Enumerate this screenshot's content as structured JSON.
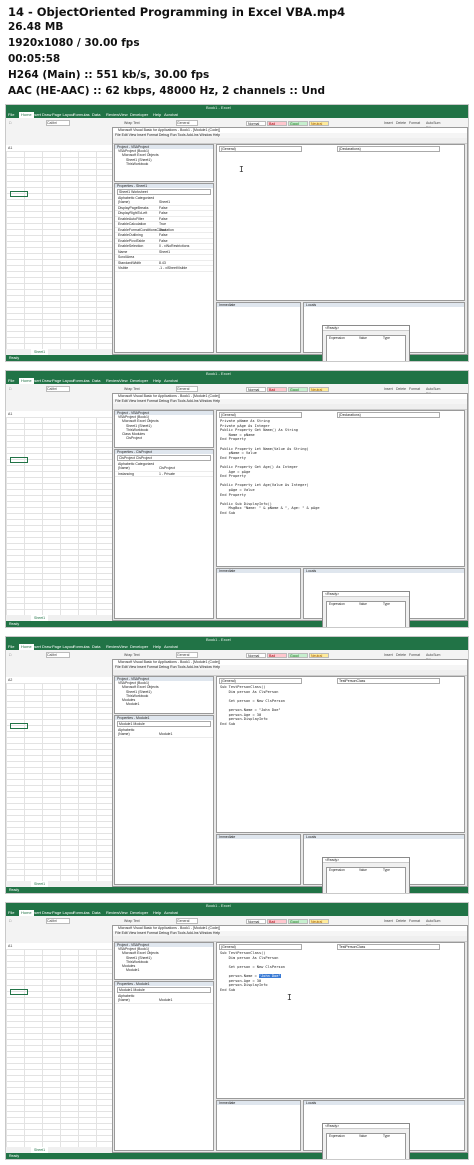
{
  "header": {
    "title": "14 - ObjectOriented Programming in Excel VBA.mp4",
    "size": "26.48 MB",
    "resolution": "1920x1080 / 30.00 fps",
    "duration": "00:05:58",
    "video": "H264 (Main) :: 551 kb/s, 30.00 fps",
    "audio": "AAC (HE-AAC) :: 62 kbps, 48000 Hz, 2 channels :: Und"
  },
  "excel": {
    "titlebar": "Book1 - Excel",
    "tabs": [
      "File",
      "Home",
      "Insert",
      "Draw",
      "Page Layout",
      "Formulas",
      "Data",
      "Review",
      "View",
      "Developer",
      "Help",
      "Acrobat"
    ],
    "ribbon": {
      "font": "Calibri",
      "wrap": "Wrap Text",
      "merge": "Merge & Center",
      "number": "General",
      "cond": "Conditional Formatting",
      "format_table": "Format as Table",
      "styles": [
        "Normal",
        "Bad",
        "Good",
        "Neutral",
        "Calculation",
        "Check Cell",
        "Explanatory",
        "Input"
      ],
      "insert": "Insert",
      "delete": "Delete",
      "format": "Format",
      "autosum": "AutoSum",
      "fill": "Fill",
      "clear": "Clear",
      "sort": "Sort & Filter",
      "find": "Find & Select"
    },
    "name_box": [
      "A1",
      "A1",
      "A2",
      "A1"
    ],
    "sheet_tab": "Sheet1",
    "status": "Ready"
  },
  "vbe": {
    "title": "Microsoft Visual Basic for Applications - Book1 - [Module1 (Code)]",
    "menu": "File  Edit  View  Insert  Format  Debug  Run  Tools  Add-Ins  Window  Help",
    "project_header": "Project - VBAProject",
    "properties_header": [
      "Properties - Sheet1",
      "Properties - ClsProject",
      "Properties - Module1",
      "Properties - Module1"
    ],
    "immediate": "Immediate",
    "locals": "Locals",
    "locals_header": [
      "<Ready>",
      "<Ready>",
      "<Ready>",
      "<Ready>"
    ],
    "locals_cols": [
      "Expression",
      "Value",
      "Type"
    ],
    "frames": [
      {
        "tree": [
          "VBAProject (Book1)",
          "Microsoft Excel Objects",
          "Sheet1 (Sheet1)",
          "ThisWorkbook"
        ],
        "prop_obj": "Sheet1 Worksheet",
        "prop_tabs": "Alphabetic  Categorized",
        "props": [
          [
            "(Name)",
            "Sheet1"
          ],
          [
            "DisplayPageBreaks",
            "False"
          ],
          [
            "DisplayRightToLeft",
            "False"
          ],
          [
            "EnableAutoFilter",
            "False"
          ],
          [
            "EnableCalculation",
            "True"
          ],
          [
            "EnableFormatConditionsCalculation",
            "True"
          ],
          [
            "EnableOutlining",
            "False"
          ],
          [
            "EnablePivotTable",
            "False"
          ],
          [
            "EnableSelection",
            "0 - xlNoRestrictions"
          ],
          [
            "Name",
            "Sheet1"
          ],
          [
            "ScrollArea",
            ""
          ],
          [
            "StandardWidth",
            "8.43"
          ],
          [
            "Visible",
            "-1 - xlSheetVisible"
          ]
        ],
        "combo_left": "(General)",
        "combo_right": "(Declarations)",
        "code": ""
      },
      {
        "tree": [
          "VBAProject (Book1)",
          "Microsoft Excel Objects",
          "Sheet1 (Sheet1)",
          "ThisWorkbook",
          "Class Modules",
          "ClsProject"
        ],
        "prop_obj": "ClsProject ClsProject",
        "prop_tabs": "Alphabetic  Categorized",
        "props": [
          [
            "(Name)",
            "ClsProject"
          ],
          [
            "Instancing",
            "1 - Private"
          ]
        ],
        "combo_left": "(General)",
        "combo_right": "(Declarations)",
        "code": "Private pName As String\nPrivate pAge As Integer\nPublic Property Get Name() As String\n    Name = pName\nEnd Property\n\nPublic Property Let Name(Value As String)\n    pName = Value\nEnd Property\n\nPublic Property Get Age() As Integer\n    Age = pAge\nEnd Property\n\nPublic Property Let Age(Value As Integer)\n    pAge = Value\nEnd Property\n\nPublic Sub DisplayInfo()\n    MsgBox \"Name: \" & pName & \", Age: \" & pAge\nEnd Sub"
      },
      {
        "tree": [
          "VBAProject (Book1)",
          "Microsoft Excel Objects",
          "Sheet1 (Sheet1)",
          "ThisWorkbook",
          "Modules",
          "Module1"
        ],
        "prop_obj": "Module1 Module",
        "prop_tabs": "Alphabetic",
        "props": [
          [
            "(Name)",
            "Module1"
          ]
        ],
        "combo_left": "(General)",
        "combo_right": "TestPersonClass",
        "code": "Sub TestPersonClass()\n    Dim person As ClsPerson\n\n    Set person = New ClsPerson\n\n    person.Name = \"John Doe\"\n    person.Age = 30\n    person.DisplayInfo\nEnd Sub"
      },
      {
        "tree": [
          "VBAProject (Book1)",
          "Microsoft Excel Objects",
          "Sheet1 (Sheet1)",
          "ThisWorkbook",
          "Modules",
          "Module1"
        ],
        "prop_obj": "Module1 Module",
        "prop_tabs": "Alphabetic",
        "props": [
          [
            "(Name)",
            "Module1"
          ]
        ],
        "combo_left": "(General)",
        "combo_right": "TestPersonClass",
        "code_before": "Sub TestPersonClass()\n    Dim person As ClsPerson\n\n    Set person = New ClsPerson\n\n    person.Name = ",
        "code_hl": "\"John Doe\"",
        "code_after": "\n    person.Age = 30\n    person.DisplayInfo\nEnd Sub"
      }
    ]
  }
}
